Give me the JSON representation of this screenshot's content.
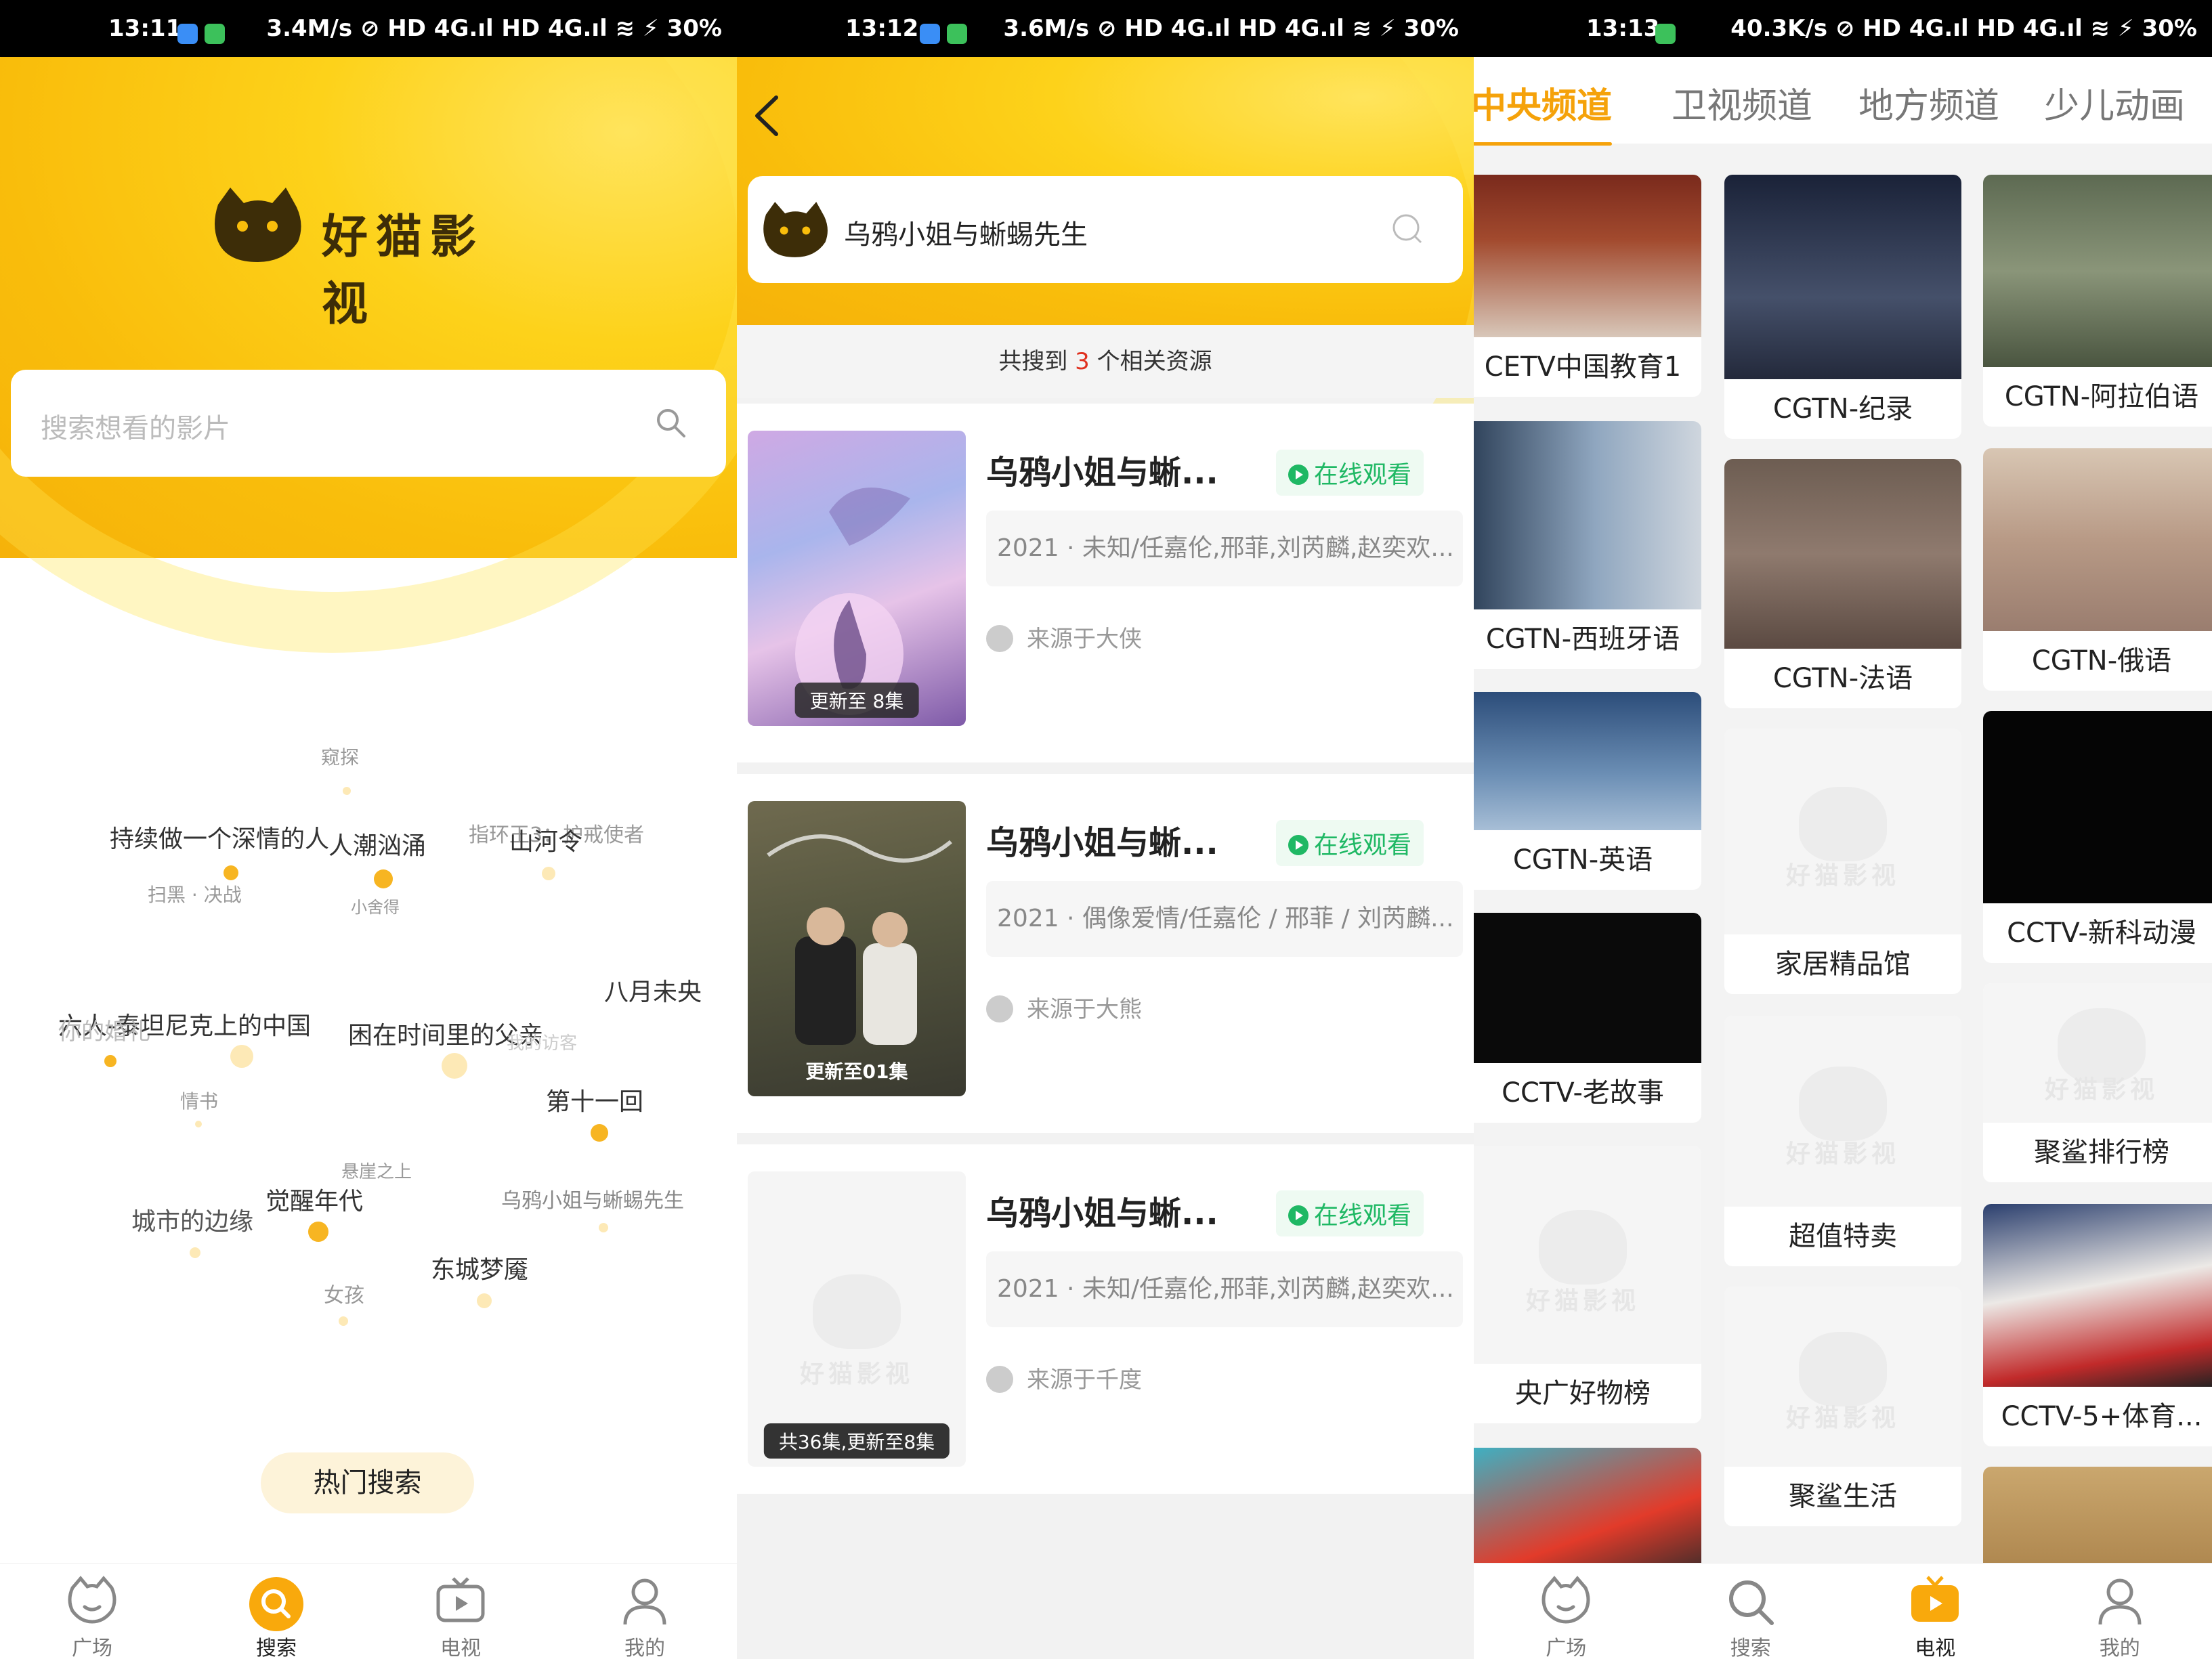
{
  "panel1": {
    "status": {
      "time": "13:11",
      "right": "3.4M/s ⊘ HD 4G.ıl HD 4G.ıl ≋ ⚡ 30%"
    },
    "logo_text": "好猫影视",
    "search_placeholder": "搜索想看的影片",
    "cloud": [
      "窥探",
      "持续做一个深情的人",
      "人潮汹涌",
      "扫黑 · 决战",
      "小舍得",
      "指环王3：护戒使者",
      "山河令",
      "八月未央",
      "六人-泰坦尼克上的中国",
      "你的婚礼",
      "困在时间里的父亲",
      "我的访客",
      "情书",
      "第十一回",
      "悬崖之上",
      "觉醒年代",
      "城市的边缘",
      "乌鸦小姐与蜥蜴先生",
      "东城梦魇",
      "女孩"
    ],
    "hot_label": "热门搜索",
    "tabs": [
      "广场",
      "搜索",
      "电视",
      "我的"
    ]
  },
  "panel2": {
    "status": {
      "time": "13:12",
      "right": "3.6M/s ⊘ HD 4G.ıl HD 4G.ıl ≋ ⚡ 30%"
    },
    "query": "乌鸦小姐与蜥蜴先生",
    "count_prefix": "共搜到",
    "count": "3",
    "count_suffix": "个相关资源",
    "watch_label": "在线观看",
    "results": [
      {
        "title": "乌鸦小姐与蜥...",
        "meta": "2021 · 未知/任嘉伦,邢菲,刘芮麟,赵奕欢...",
        "source": "来源于大侠",
        "badge": "更新至 8集"
      },
      {
        "title": "乌鸦小姐与蜥...",
        "meta": "2021 · 偶像爱情/任嘉伦 / 邢菲 / 刘芮麟...",
        "source": "来源于大熊",
        "badge": "更新至01集"
      },
      {
        "title": "乌鸦小姐与蜥...",
        "meta": "2021 · 未知/任嘉伦,邢菲,刘芮麟,赵奕欢...",
        "source": "来源于千度",
        "badge": "共36集,更新至8集"
      }
    ],
    "placeholder_logo": "好猫影视"
  },
  "panel3": {
    "status": {
      "time": "13:13",
      "right": "40.3K/s ⊘ HD 4G.ıl HD 4G.ıl ≋ ⚡ 30%"
    },
    "tabs": [
      "中央频道",
      "卫视频道",
      "地方频道",
      "少儿动画"
    ],
    "col1": [
      "CETV中国教育1",
      "CGTN-西班牙语",
      "CGTN-英语",
      "CCTV-老故事",
      "央广好物榜"
    ],
    "col2": [
      "CGTN-纪录",
      "CGTN-法语",
      "家居精品馆",
      "超值特卖",
      "聚鲨生活"
    ],
    "col3": [
      "CGTN-阿拉伯语",
      "CGTN-俄语",
      "CCTV-新科动漫",
      "聚鲨排行榜",
      "CCTV-5+体育..."
    ],
    "placeholder_logo": "好猫影视",
    "tabs_bottom": [
      "广场",
      "搜索",
      "电视",
      "我的"
    ]
  },
  "colors": {
    "yellow": "#f9bd0b",
    "accent": "#f5a20a",
    "green": "#1fb864",
    "red": "#e0301e"
  }
}
